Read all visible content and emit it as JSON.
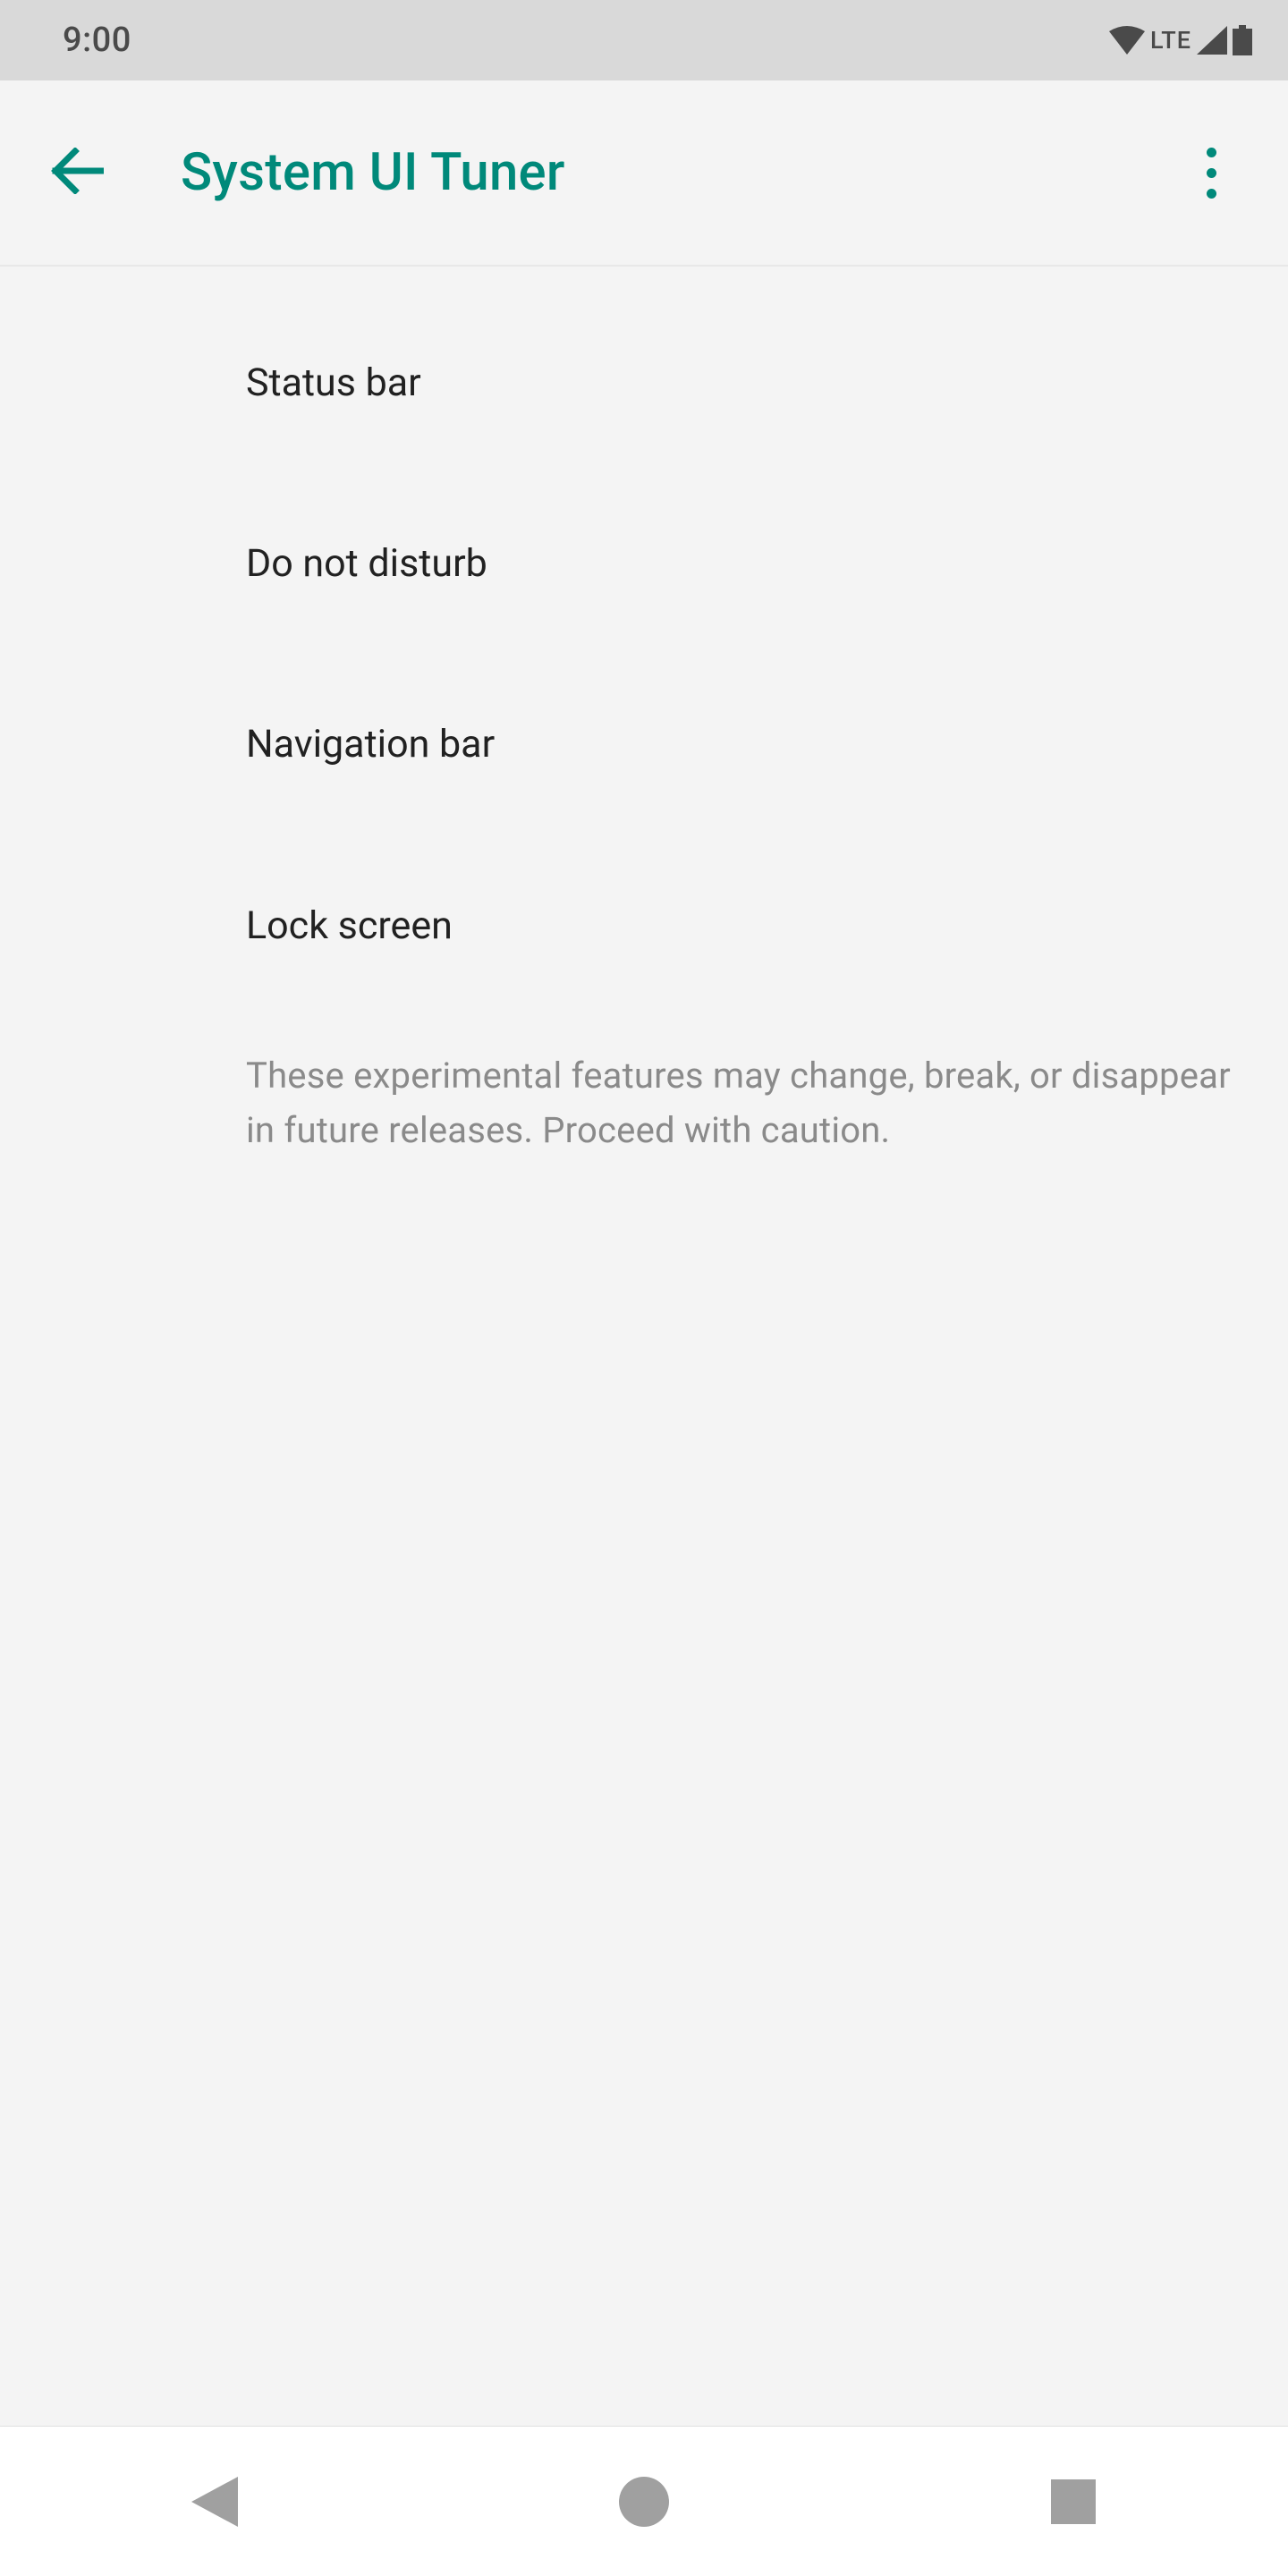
{
  "statusbar": {
    "time": "9:00",
    "network_label": "LTE"
  },
  "appbar": {
    "title": "System UI Tuner"
  },
  "menu": {
    "items": [
      "Status bar",
      "Do not disturb",
      "Navigation bar",
      "Lock screen"
    ],
    "caution": "These experimental features may change, break, or disappear in future releases. Proceed with caution."
  },
  "colors": {
    "accent": "#00897A"
  }
}
